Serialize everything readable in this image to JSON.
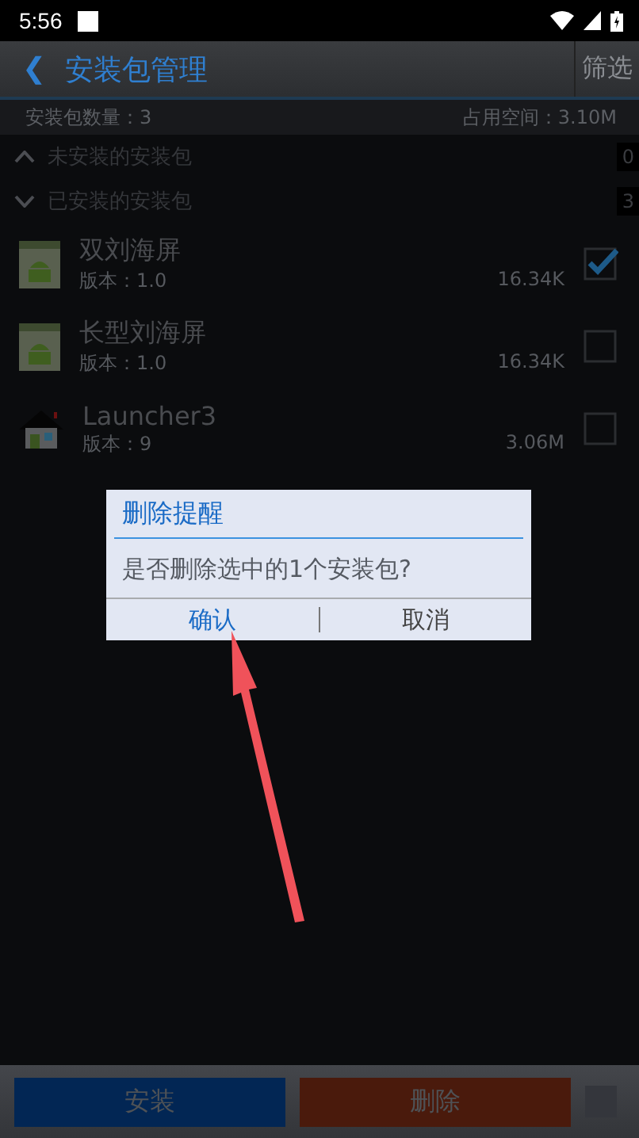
{
  "status_bar": {
    "time": "5:56"
  },
  "toolbar": {
    "back": "❮",
    "title": "安装包管理",
    "filter_button": "筛选"
  },
  "summary": {
    "count_label": "安装包数量：",
    "count": "3",
    "space_label": "占用空间：",
    "space": "3.10M"
  },
  "groups": [
    {
      "label": "未安装的安装包",
      "count": "0",
      "expanded": false
    },
    {
      "label": "已安装的安装包",
      "count": "3",
      "expanded": true
    }
  ],
  "packages": [
    {
      "kind": "android",
      "name": "双刘海屏",
      "version_label": "版本：",
      "version": "1.0",
      "size": "16.34K",
      "checked": true
    },
    {
      "kind": "android",
      "name": "长型刘海屏",
      "version_label": "版本：",
      "version": "1.0",
      "size": "16.34K",
      "checked": false
    },
    {
      "kind": "home",
      "name": "Launcher3",
      "version_label": "版本：",
      "version": "9",
      "size": "3.06M",
      "checked": false
    }
  ],
  "dialog": {
    "title": "删除提醒",
    "message": "是否删除选中的1个安装包?",
    "buttons": [
      "确认",
      "取消"
    ]
  },
  "bottom_bar": {
    "install": "安装",
    "delete": "删除",
    "select_all_checked": false
  }
}
